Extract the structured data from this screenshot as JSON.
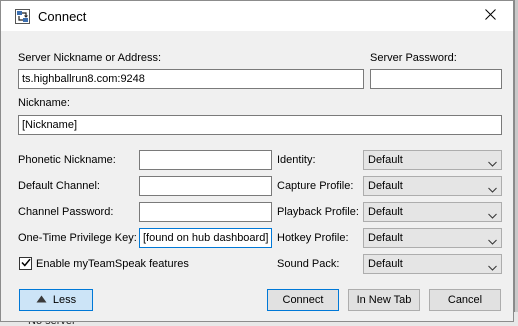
{
  "window": {
    "title": "Connect",
    "app_icon": "teamspeak-connect-icon",
    "close_icon": "close-icon"
  },
  "form": {
    "server_label": "Server Nickname or Address:",
    "server_value": "ts.highballrun8.com:9248",
    "password_label": "Server Password:",
    "password_value": "",
    "nickname_label": "Nickname:",
    "nickname_value": "[Nickname]",
    "phonetic_label": "Phonetic Nickname:",
    "phonetic_value": "",
    "default_channel_label": "Default Channel:",
    "default_channel_value": "",
    "channel_password_label": "Channel Password:",
    "channel_password_value": "",
    "privilege_key_label": "One-Time Privilege Key:",
    "privilege_key_value": "[found on hub dashboard]",
    "myteamspeak_label": "Enable myTeamSpeak features",
    "myteamspeak_checked": true
  },
  "profiles": {
    "identity_label": "Identity:",
    "identity_value": "Default",
    "capture_label": "Capture Profile:",
    "capture_value": "Default",
    "playback_label": "Playback Profile:",
    "playback_value": "Default",
    "hotkey_label": "Hotkey Profile:",
    "hotkey_value": "Default",
    "soundpack_label": "Sound Pack:",
    "soundpack_value": "Default"
  },
  "buttons": {
    "less_label": "Less",
    "connect_label": "Connect",
    "new_tab_label": "In New Tab",
    "cancel_label": "Cancel"
  },
  "background": {
    "status_text": "No server"
  },
  "colors": {
    "accent": "#0078d7",
    "window_bg": "#f0f0f0",
    "less_button_bg": "#cce4f7"
  }
}
